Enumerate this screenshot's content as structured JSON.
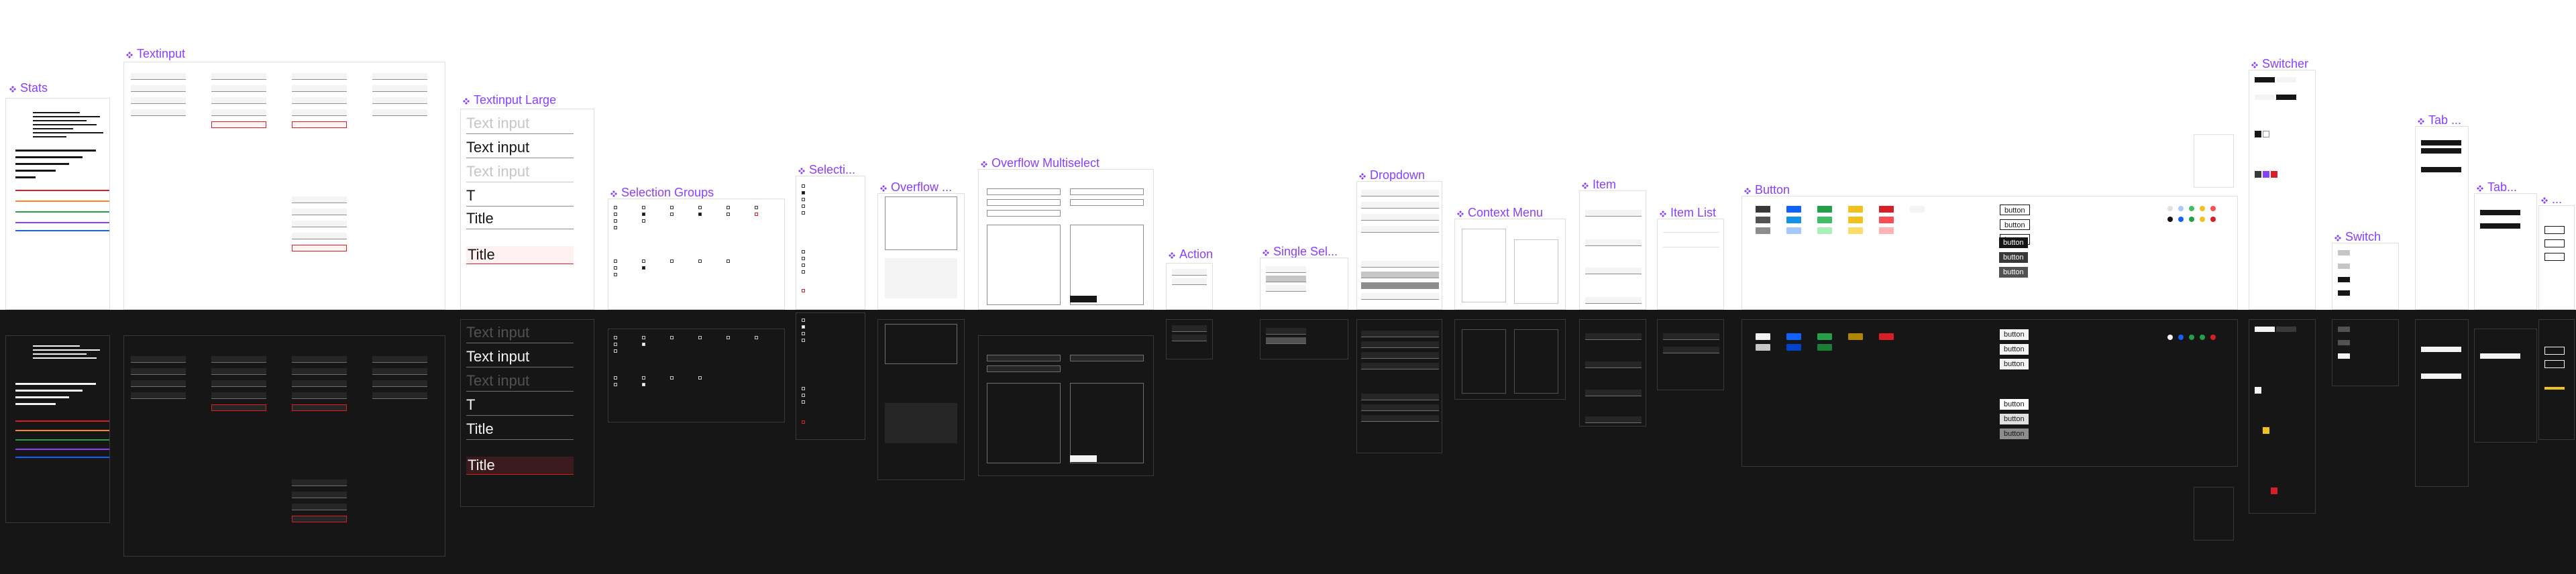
{
  "colors": {
    "accent": "#8a3ffc",
    "dark_bg": "#161616",
    "error": "#da1e28",
    "field_bg": "#f4f4f4"
  },
  "sections": {
    "stats": "Stats",
    "textinput": "Textinput",
    "textinput_large": "Textinput Large",
    "selection_groups": "Selection Groups",
    "selection_short": "Selecti...",
    "overflow": "Overflow ...",
    "overflow_multiselect": "Overflow Multiselect",
    "action": "Action",
    "single_sel": "Single Sel...",
    "dropdown": "Dropdown",
    "context_menu": "Context Menu",
    "item": "Item",
    "item_list": "Item List",
    "button": "Button",
    "switcher": "Switcher",
    "switch": "Switch",
    "tab1": "Tab ...",
    "tab2": "Tab...",
    "tab3": "..."
  },
  "textinput_large": {
    "placeholder": "Text input",
    "value": "Text input",
    "cursor_value": "T",
    "title_value": "Title",
    "title_error_value": "Title"
  },
  "button": {
    "label": "button"
  }
}
